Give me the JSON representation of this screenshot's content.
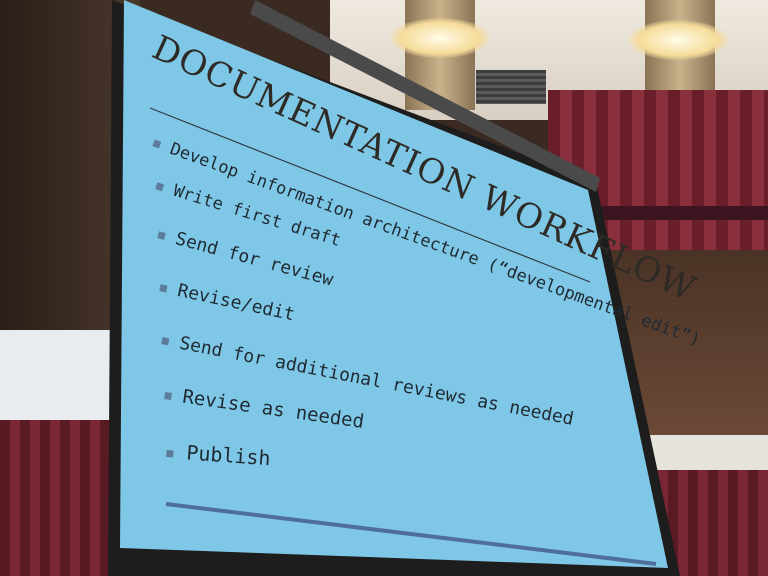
{
  "slide": {
    "title": "DOCUMENTATION WORKFLOW",
    "bullets": [
      "Develop information architecture (“developmental edit”)",
      "Write first draft",
      "Send for review",
      "Revise/edit",
      "Send for additional reviews as needed",
      "Revise as needed",
      "Publish"
    ]
  },
  "colors": {
    "screen": "#7fc7e6",
    "curtain": "#7a2634",
    "title_text": "#2e2a26",
    "bullet_text": "#1f2a33",
    "rule": "#4f6f9a"
  }
}
